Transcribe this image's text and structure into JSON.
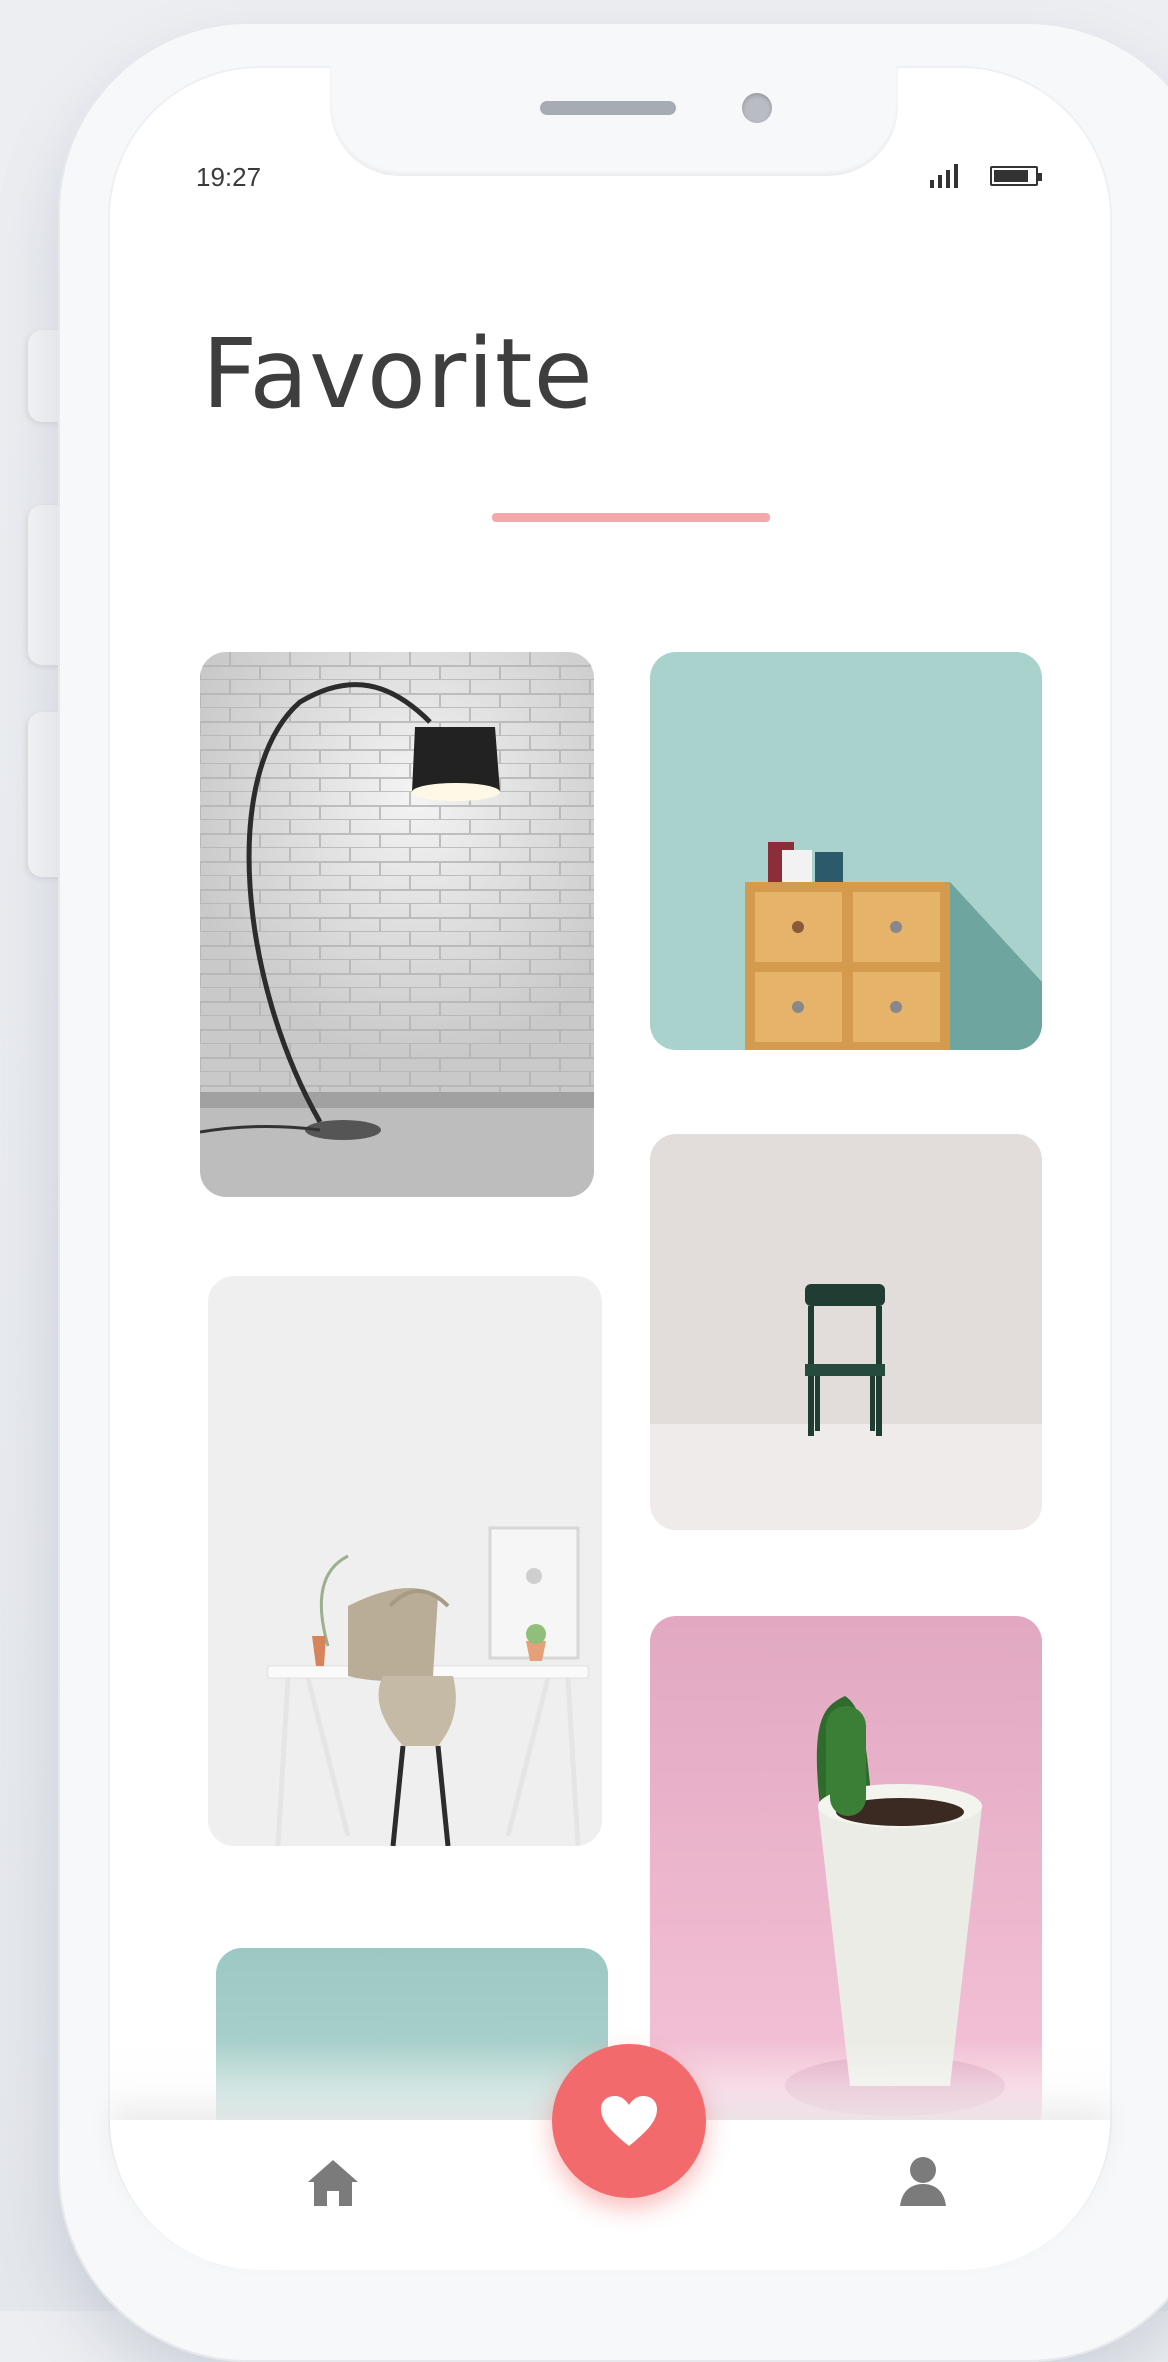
{
  "status_bar": {
    "time": "19:27"
  },
  "header": {
    "title": "Favorite"
  },
  "colors": {
    "accent": "#f26a6b",
    "underline": "#f6a7aa",
    "text": "#3e3e3e"
  },
  "favorites": [
    {
      "name": "floor-lamp"
    },
    {
      "name": "drawer-cabinet"
    },
    {
      "name": "green-chair"
    },
    {
      "name": "white-desk"
    },
    {
      "name": "cactus-pot"
    },
    {
      "name": "teal-item"
    }
  ],
  "nav": {
    "home_icon": "home-icon",
    "favorite_icon": "heart-icon",
    "profile_icon": "user-icon"
  }
}
